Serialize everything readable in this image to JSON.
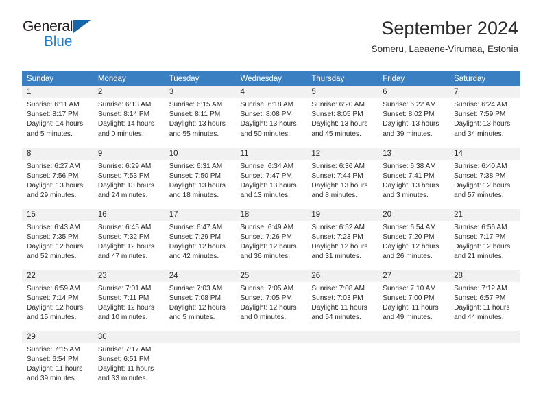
{
  "brand": {
    "line1": "General",
    "line2": "Blue",
    "triangle_color": "#1565a8",
    "line2_color": "#1f7fd0"
  },
  "header": {
    "title": "September 2024",
    "subtitle": "Someru, Laeaene-Virumaa, Estonia"
  },
  "colors": {
    "header_row_bg": "#3a7fc1",
    "daynum_band_bg": "#f1f1f1",
    "row_divider": "#9f9f9f",
    "text": "#2b2b2b"
  },
  "weekday_headers": [
    "Sunday",
    "Monday",
    "Tuesday",
    "Wednesday",
    "Thursday",
    "Friday",
    "Saturday"
  ],
  "labels": {
    "sunrise_prefix": "Sunrise:",
    "sunset_prefix": "Sunset:",
    "daylight_prefix": "Daylight:"
  },
  "weeks": [
    [
      {
        "day": "1",
        "l1": "Sunrise: 6:11 AM",
        "l2": "Sunset: 8:17 PM",
        "l3": "Daylight: 14 hours",
        "l4": "and 5 minutes."
      },
      {
        "day": "2",
        "l1": "Sunrise: 6:13 AM",
        "l2": "Sunset: 8:14 PM",
        "l3": "Daylight: 14 hours",
        "l4": "and 0 minutes."
      },
      {
        "day": "3",
        "l1": "Sunrise: 6:15 AM",
        "l2": "Sunset: 8:11 PM",
        "l3": "Daylight: 13 hours",
        "l4": "and 55 minutes."
      },
      {
        "day": "4",
        "l1": "Sunrise: 6:18 AM",
        "l2": "Sunset: 8:08 PM",
        "l3": "Daylight: 13 hours",
        "l4": "and 50 minutes."
      },
      {
        "day": "5",
        "l1": "Sunrise: 6:20 AM",
        "l2": "Sunset: 8:05 PM",
        "l3": "Daylight: 13 hours",
        "l4": "and 45 minutes."
      },
      {
        "day": "6",
        "l1": "Sunrise: 6:22 AM",
        "l2": "Sunset: 8:02 PM",
        "l3": "Daylight: 13 hours",
        "l4": "and 39 minutes."
      },
      {
        "day": "7",
        "l1": "Sunrise: 6:24 AM",
        "l2": "Sunset: 7:59 PM",
        "l3": "Daylight: 13 hours",
        "l4": "and 34 minutes."
      }
    ],
    [
      {
        "day": "8",
        "l1": "Sunrise: 6:27 AM",
        "l2": "Sunset: 7:56 PM",
        "l3": "Daylight: 13 hours",
        "l4": "and 29 minutes."
      },
      {
        "day": "9",
        "l1": "Sunrise: 6:29 AM",
        "l2": "Sunset: 7:53 PM",
        "l3": "Daylight: 13 hours",
        "l4": "and 24 minutes."
      },
      {
        "day": "10",
        "l1": "Sunrise: 6:31 AM",
        "l2": "Sunset: 7:50 PM",
        "l3": "Daylight: 13 hours",
        "l4": "and 18 minutes."
      },
      {
        "day": "11",
        "l1": "Sunrise: 6:34 AM",
        "l2": "Sunset: 7:47 PM",
        "l3": "Daylight: 13 hours",
        "l4": "and 13 minutes."
      },
      {
        "day": "12",
        "l1": "Sunrise: 6:36 AM",
        "l2": "Sunset: 7:44 PM",
        "l3": "Daylight: 13 hours",
        "l4": "and 8 minutes."
      },
      {
        "day": "13",
        "l1": "Sunrise: 6:38 AM",
        "l2": "Sunset: 7:41 PM",
        "l3": "Daylight: 13 hours",
        "l4": "and 3 minutes."
      },
      {
        "day": "14",
        "l1": "Sunrise: 6:40 AM",
        "l2": "Sunset: 7:38 PM",
        "l3": "Daylight: 12 hours",
        "l4": "and 57 minutes."
      }
    ],
    [
      {
        "day": "15",
        "l1": "Sunrise: 6:43 AM",
        "l2": "Sunset: 7:35 PM",
        "l3": "Daylight: 12 hours",
        "l4": "and 52 minutes."
      },
      {
        "day": "16",
        "l1": "Sunrise: 6:45 AM",
        "l2": "Sunset: 7:32 PM",
        "l3": "Daylight: 12 hours",
        "l4": "and 47 minutes."
      },
      {
        "day": "17",
        "l1": "Sunrise: 6:47 AM",
        "l2": "Sunset: 7:29 PM",
        "l3": "Daylight: 12 hours",
        "l4": "and 42 minutes."
      },
      {
        "day": "18",
        "l1": "Sunrise: 6:49 AM",
        "l2": "Sunset: 7:26 PM",
        "l3": "Daylight: 12 hours",
        "l4": "and 36 minutes."
      },
      {
        "day": "19",
        "l1": "Sunrise: 6:52 AM",
        "l2": "Sunset: 7:23 PM",
        "l3": "Daylight: 12 hours",
        "l4": "and 31 minutes."
      },
      {
        "day": "20",
        "l1": "Sunrise: 6:54 AM",
        "l2": "Sunset: 7:20 PM",
        "l3": "Daylight: 12 hours",
        "l4": "and 26 minutes."
      },
      {
        "day": "21",
        "l1": "Sunrise: 6:56 AM",
        "l2": "Sunset: 7:17 PM",
        "l3": "Daylight: 12 hours",
        "l4": "and 21 minutes."
      }
    ],
    [
      {
        "day": "22",
        "l1": "Sunrise: 6:59 AM",
        "l2": "Sunset: 7:14 PM",
        "l3": "Daylight: 12 hours",
        "l4": "and 15 minutes."
      },
      {
        "day": "23",
        "l1": "Sunrise: 7:01 AM",
        "l2": "Sunset: 7:11 PM",
        "l3": "Daylight: 12 hours",
        "l4": "and 10 minutes."
      },
      {
        "day": "24",
        "l1": "Sunrise: 7:03 AM",
        "l2": "Sunset: 7:08 PM",
        "l3": "Daylight: 12 hours",
        "l4": "and 5 minutes."
      },
      {
        "day": "25",
        "l1": "Sunrise: 7:05 AM",
        "l2": "Sunset: 7:05 PM",
        "l3": "Daylight: 12 hours",
        "l4": "and 0 minutes."
      },
      {
        "day": "26",
        "l1": "Sunrise: 7:08 AM",
        "l2": "Sunset: 7:03 PM",
        "l3": "Daylight: 11 hours",
        "l4": "and 54 minutes."
      },
      {
        "day": "27",
        "l1": "Sunrise: 7:10 AM",
        "l2": "Sunset: 7:00 PM",
        "l3": "Daylight: 11 hours",
        "l4": "and 49 minutes."
      },
      {
        "day": "28",
        "l1": "Sunrise: 7:12 AM",
        "l2": "Sunset: 6:57 PM",
        "l3": "Daylight: 11 hours",
        "l4": "and 44 minutes."
      }
    ],
    [
      {
        "day": "29",
        "l1": "Sunrise: 7:15 AM",
        "l2": "Sunset: 6:54 PM",
        "l3": "Daylight: 11 hours",
        "l4": "and 39 minutes."
      },
      {
        "day": "30",
        "l1": "Sunrise: 7:17 AM",
        "l2": "Sunset: 6:51 PM",
        "l3": "Daylight: 11 hours",
        "l4": "and 33 minutes."
      },
      {
        "day": "",
        "l1": "",
        "l2": "",
        "l3": "",
        "l4": ""
      },
      {
        "day": "",
        "l1": "",
        "l2": "",
        "l3": "",
        "l4": ""
      },
      {
        "day": "",
        "l1": "",
        "l2": "",
        "l3": "",
        "l4": ""
      },
      {
        "day": "",
        "l1": "",
        "l2": "",
        "l3": "",
        "l4": ""
      },
      {
        "day": "",
        "l1": "",
        "l2": "",
        "l3": "",
        "l4": ""
      }
    ]
  ]
}
